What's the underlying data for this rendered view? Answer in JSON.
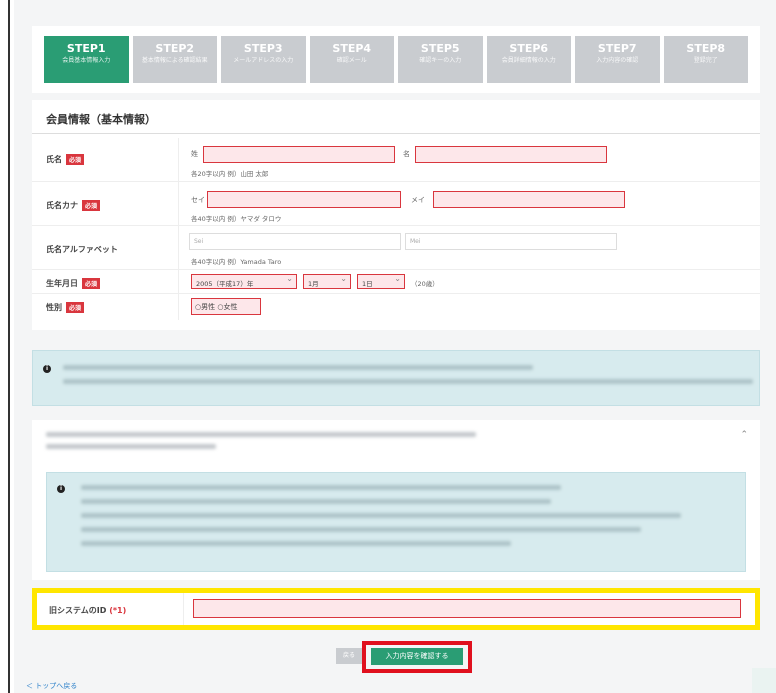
{
  "steps": [
    {
      "title": "STEP1",
      "sub": "会員基本情報入力",
      "active": true
    },
    {
      "title": "STEP2",
      "sub": "基本情報による確認結果"
    },
    {
      "title": "STEP3",
      "sub": "メールアドレスの入力"
    },
    {
      "title": "STEP4",
      "sub": "確認メール"
    },
    {
      "title": "STEP5",
      "sub": "確認キーの入力"
    },
    {
      "title": "STEP6",
      "sub": "会員詳細情報の入力"
    },
    {
      "title": "STEP7",
      "sub": "入力内容の確認"
    },
    {
      "title": "STEP8",
      "sub": "登録完了"
    }
  ],
  "panel": {
    "title": "会員情報（基本情報）",
    "required_badge": "必須",
    "name": {
      "label": "氏名",
      "sei_prefix": "姓",
      "mei_prefix": "名",
      "hint": "各20字以内 例）山田 太郎"
    },
    "kana": {
      "label": "氏名カナ",
      "sei_prefix": "セイ",
      "mei_prefix": "メイ",
      "hint": "各40字以内 例）ヤマダ タロウ"
    },
    "alpha": {
      "label": "氏名アルファベット",
      "sei_placeholder": "Sei",
      "mei_placeholder": "Mei",
      "hint": "各40字以内 例）Yamada Taro"
    },
    "birth": {
      "label": "生年月日",
      "year": "2005（平成17）年",
      "month": "1月",
      "day": "1日",
      "age": "（20歳）"
    },
    "gender": {
      "label": "性別",
      "options": "○男性 ○女性"
    }
  },
  "id_field": {
    "label": "旧システムのID",
    "mark": "(*1)"
  },
  "buttons": {
    "back": "戻る",
    "confirm": "入力内容を確認する"
  },
  "footer": {
    "top_link": "＜ トップへ戻る"
  },
  "icons": {
    "info": "info-circle-icon",
    "chevron": "chevron-up-icon"
  },
  "colors": {
    "accent": "#2a9d74",
    "required": "#d9363e",
    "highlight_yellow": "#ffe600",
    "highlight_red": "#e0101e"
  }
}
